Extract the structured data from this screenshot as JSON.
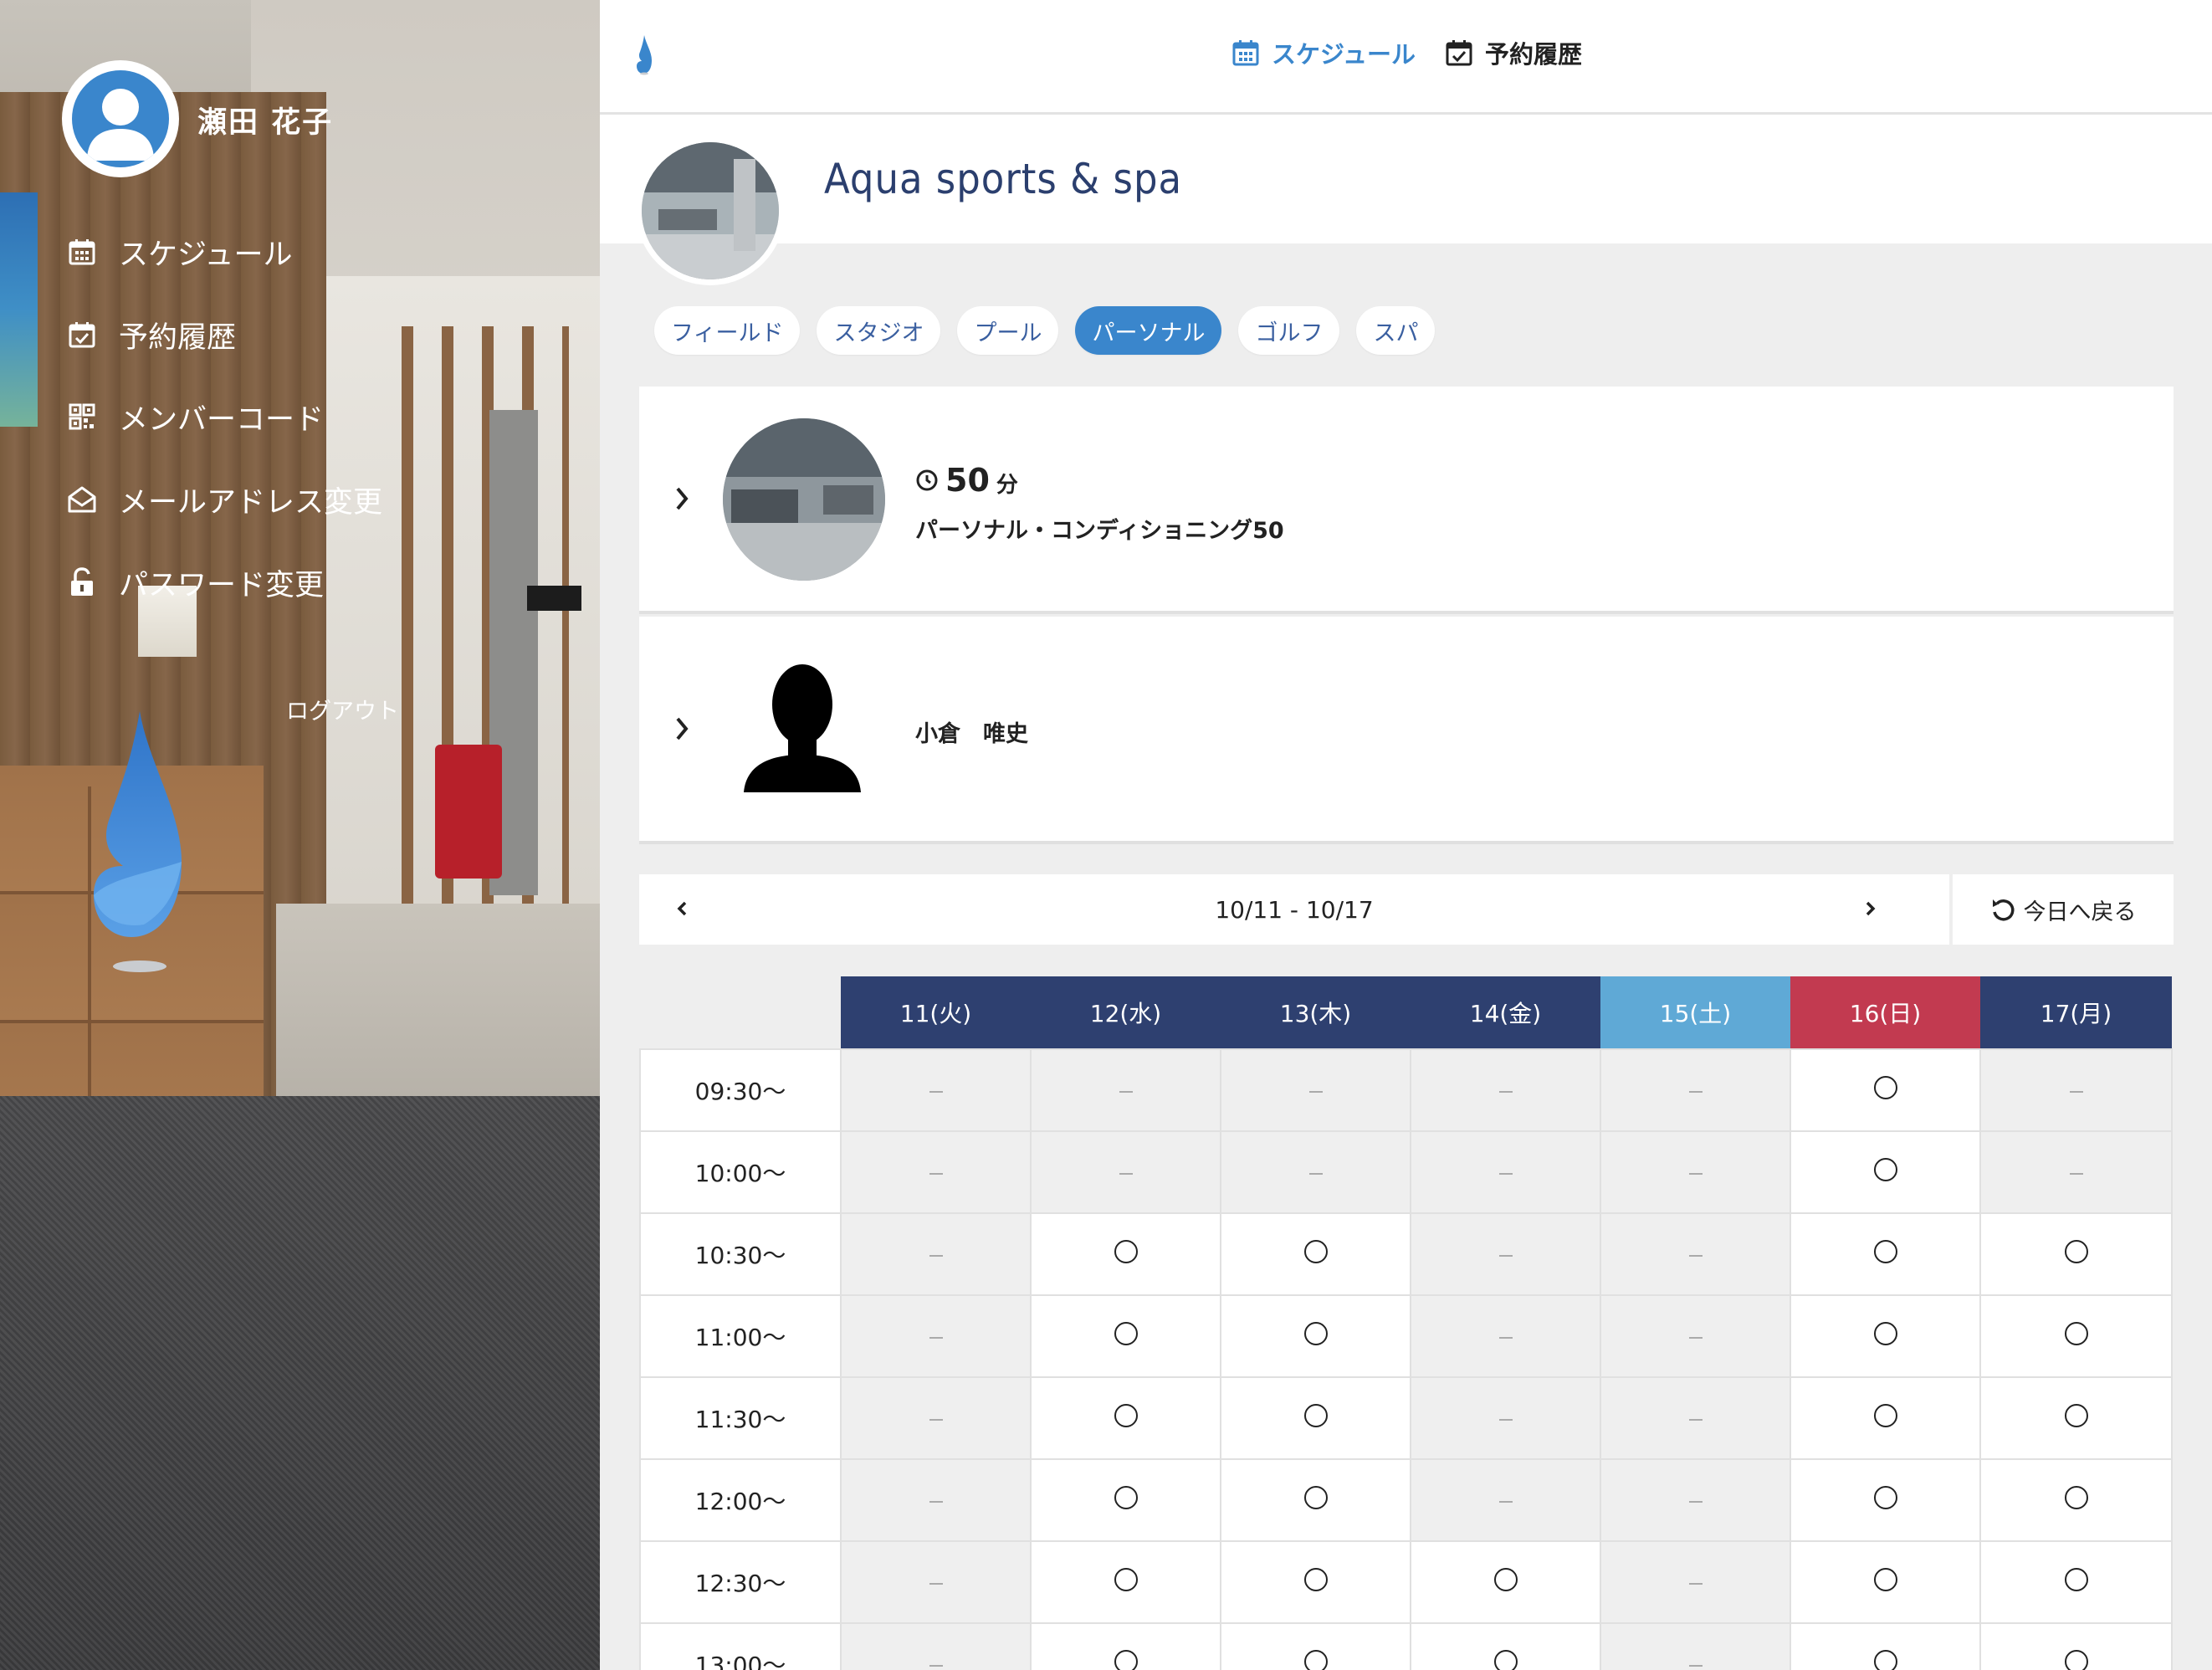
{
  "user": {
    "name": "瀬田 花子"
  },
  "sidebar": {
    "items": [
      {
        "label": "スケジュール",
        "icon": "calendar-icon"
      },
      {
        "label": "予約履歴",
        "icon": "calendar-check-icon"
      },
      {
        "label": "メンバーコード",
        "icon": "qr-code-icon"
      },
      {
        "label": "メールアドレス変更",
        "icon": "mail-open-icon"
      },
      {
        "label": "パスワード変更",
        "icon": "unlock-icon"
      }
    ],
    "logout_label": "ログアウト"
  },
  "topnav": {
    "schedule_label": "スケジュール",
    "history_label": "予約履歴",
    "active_color": "#3a86cc"
  },
  "facility": {
    "name": "Aqua sports & spa"
  },
  "tabs": [
    {
      "label": "フィールド",
      "active": false
    },
    {
      "label": "スタジオ",
      "active": false
    },
    {
      "label": "プール",
      "active": false
    },
    {
      "label": "パーソナル",
      "active": true
    },
    {
      "label": "ゴルフ",
      "active": false
    },
    {
      "label": "スパ",
      "active": false
    }
  ],
  "menu": {
    "duration_value": "50",
    "duration_unit": "分",
    "title": "パーソナル・コンディショニング50"
  },
  "trainer": {
    "name": "小倉　唯史"
  },
  "week": {
    "range": "10/11 - 10/17",
    "today_label": "今日へ戻る"
  },
  "colors": {
    "weekday_header": "#2e4070",
    "saturday_header": "#5fa9d6",
    "sunday_header": "#c23a50",
    "brand_blue": "#3a86cc"
  },
  "schedule": {
    "days": [
      "11(火)",
      "12(水)",
      "13(木)",
      "14(金)",
      "15(土)",
      "16(日)",
      "17(月)"
    ],
    "rows": [
      {
        "time": "09:30〜",
        "slots": [
          "-",
          "-",
          "-",
          "-",
          "-",
          "o",
          "-"
        ]
      },
      {
        "time": "10:00〜",
        "slots": [
          "-",
          "-",
          "-",
          "-",
          "-",
          "o",
          "-"
        ]
      },
      {
        "time": "10:30〜",
        "slots": [
          "-",
          "o",
          "o",
          "-",
          "-",
          "o",
          "o"
        ]
      },
      {
        "time": "11:00〜",
        "slots": [
          "-",
          "o",
          "o",
          "-",
          "-",
          "o",
          "o"
        ]
      },
      {
        "time": "11:30〜",
        "slots": [
          "-",
          "o",
          "o",
          "-",
          "-",
          "o",
          "o"
        ]
      },
      {
        "time": "12:00〜",
        "slots": [
          "-",
          "o",
          "o",
          "-",
          "-",
          "o",
          "o"
        ]
      },
      {
        "time": "12:30〜",
        "slots": [
          "-",
          "o",
          "o",
          "o",
          "-",
          "o",
          "o"
        ]
      },
      {
        "time": "13:00〜",
        "slots": [
          "-",
          "o",
          "o",
          "o",
          "-",
          "o",
          "o"
        ]
      }
    ]
  }
}
